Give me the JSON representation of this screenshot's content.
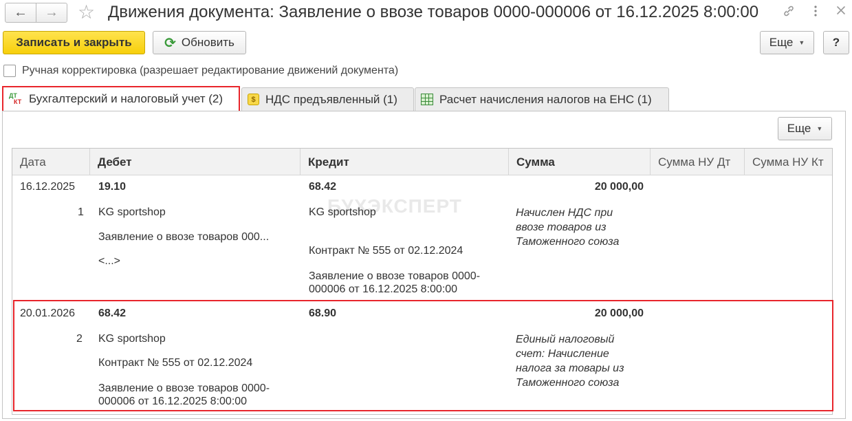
{
  "window": {
    "title": "Движения документа: Заявление о ввозе товаров 0000-000006 от 16.12.2025 8:00:00",
    "back_icon": "arrow-left-icon",
    "forward_icon": "arrow-right-icon",
    "favorite_icon": "star-icon",
    "link_icon": "link-icon",
    "menu_icon": "more-vertical-icon",
    "close_icon": "close-icon"
  },
  "toolbar": {
    "save_close_label": "Записать и закрыть",
    "refresh_label": "Обновить",
    "more_label": "Еще",
    "help_label": "?"
  },
  "manual_correction": {
    "label": "Ручная корректировка (разрешает редактирование движений документа)",
    "checked": false
  },
  "tabs": [
    {
      "label": "Бухгалтерский и налоговый учет (2)",
      "icon": "dt-kt-icon",
      "active": true
    },
    {
      "label": "НДС предъявленный (1)",
      "icon": "coin-icon",
      "active": false
    },
    {
      "label": "Расчет начисления налогов на ЕНС (1)",
      "icon": "table-icon",
      "active": false
    }
  ],
  "grid": {
    "more_label": "Еще",
    "columns": [
      "Дата",
      "Дебет",
      "Кредит",
      "Сумма",
      "Сумма НУ Дт",
      "Сумма НУ Кт"
    ],
    "rows": [
      {
        "date": "16.12.2025",
        "number": "1",
        "debit_account": "19.10",
        "debit_sub1": "KG sportshop",
        "debit_sub2": "Заявление о ввозе товаров 000...",
        "debit_sub3": "<...>",
        "credit_account": "68.42",
        "credit_sub1": "KG sportshop",
        "credit_sub2": "Контракт № 555 от 02.12.2024",
        "credit_sub3": "Заявление о ввозе товаров 0000-000006 от 16.12.2025 8:00:00",
        "amount": "20 000,00",
        "content": "Начислен НДС при ввозе товаров из Таможенного союза"
      },
      {
        "date": "20.01.2026",
        "number": "2",
        "debit_account": "68.42",
        "debit_sub1": "KG sportshop",
        "debit_sub2": "Контракт № 555 от 02.12.2024",
        "debit_sub3": "Заявление о ввозе товаров 0000-000006 от 16.12.2025 8:00:00",
        "credit_account": "68.90",
        "amount": "20 000,00",
        "content": "Единый налоговый счет: Начисление налога за товары из Таможенного союза"
      }
    ]
  },
  "watermark": "БУХЭКСПЕРТ",
  "colors": {
    "primary_button": "#f7cf0b",
    "highlight_border": "#e8252b",
    "header_bg": "#f2f2f2"
  }
}
